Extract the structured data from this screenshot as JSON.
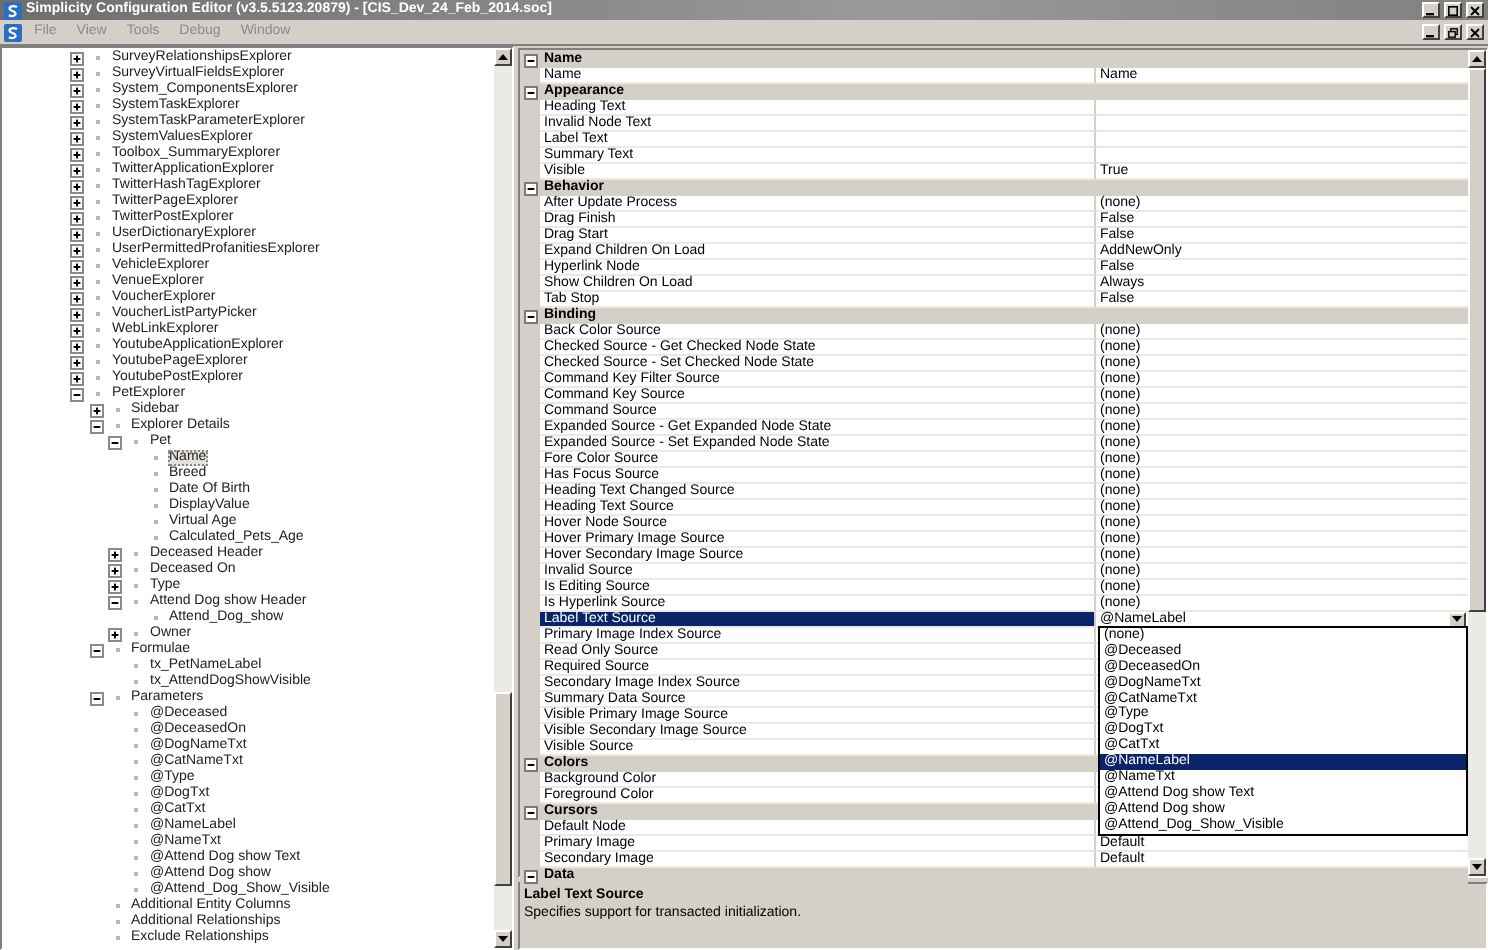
{
  "window": {
    "title": "Simplicity Configuration Editor (v3.5.5123.20879) - [CIS_Dev_24_Feb_2014.soc]"
  },
  "menu": [
    "File",
    "View",
    "Tools",
    "Debug",
    "Window"
  ],
  "tree": [
    {
      "label": "SurveyRelationshipsExplorer",
      "expanded": false,
      "selected": false
    },
    {
      "label": "SurveyVirtualFieldsExplorer",
      "expanded": false,
      "selected": false
    },
    {
      "label": "System_ComponentsExplorer",
      "expanded": false,
      "selected": false
    },
    {
      "label": "SystemTaskExplorer",
      "expanded": false,
      "selected": false
    },
    {
      "label": "SystemTaskParameterExplorer",
      "expanded": false,
      "selected": false
    },
    {
      "label": "SystemValuesExplorer",
      "expanded": false,
      "selected": false
    },
    {
      "label": "Toolbox_SummaryExplorer",
      "expanded": false,
      "selected": false
    },
    {
      "label": "TwitterApplicationExplorer",
      "expanded": false,
      "selected": false
    },
    {
      "label": "TwitterHashTagExplorer",
      "expanded": false,
      "selected": false
    },
    {
      "label": "TwitterPageExplorer",
      "expanded": false,
      "selected": false
    },
    {
      "label": "TwitterPostExplorer",
      "expanded": false,
      "selected": false
    },
    {
      "label": "UserDictionaryExplorer",
      "expanded": false,
      "selected": false
    },
    {
      "label": "UserPermittedProfanitiesExplorer",
      "expanded": false,
      "selected": false
    },
    {
      "label": "VehicleExplorer",
      "expanded": false,
      "selected": false
    },
    {
      "label": "VenueExplorer",
      "expanded": false,
      "selected": false
    },
    {
      "label": "VoucherExplorer",
      "expanded": false,
      "selected": false
    },
    {
      "label": "VoucherListPartyPicker",
      "expanded": false,
      "selected": false
    },
    {
      "label": "WebLinkExplorer",
      "expanded": false,
      "selected": false
    },
    {
      "label": "YoutubeApplicationExplorer",
      "expanded": false,
      "selected": false
    },
    {
      "label": "YoutubePageExplorer",
      "expanded": false,
      "selected": false
    },
    {
      "label": "YoutubePostExplorer",
      "expanded": false,
      "selected": false
    },
    {
      "label": "PetExplorer",
      "expanded": true,
      "selected": false,
      "children": [
        {
          "label": "Sidebar",
          "expanded": false,
          "selected": false
        },
        {
          "label": "Explorer Details",
          "expanded": true,
          "selected": false,
          "children": [
            {
              "label": "Pet",
              "expanded": true,
              "selected": false,
              "children": [
                {
                  "label": "Name",
                  "selected": true
                },
                {
                  "label": "Breed",
                  "selected": false
                },
                {
                  "label": "Date Of Birth",
                  "selected": false
                },
                {
                  "label": "DisplayValue",
                  "selected": false
                },
                {
                  "label": "Virtual Age",
                  "selected": false
                },
                {
                  "label": "Calculated_Pets_Age",
                  "selected": false
                }
              ]
            },
            {
              "label": "Deceased Header",
              "expanded": false,
              "selected": false
            },
            {
              "label": "Deceased On",
              "expanded": false,
              "selected": false
            },
            {
              "label": "Type",
              "expanded": false,
              "selected": false
            },
            {
              "label": "Attend Dog show Header",
              "expanded": true,
              "selected": false,
              "children": [
                {
                  "label": "Attend_Dog_show",
                  "selected": false
                }
              ]
            },
            {
              "label": "Owner",
              "expanded": false,
              "selected": false
            }
          ]
        },
        {
          "label": "Formulae",
          "expanded": true,
          "selected": false,
          "children": [
            {
              "label": "tx_PetNameLabel",
              "selected": false
            },
            {
              "label": "tx_AttendDogShowVisible",
              "selected": false
            }
          ]
        },
        {
          "label": "Parameters",
          "expanded": true,
          "selected": false,
          "children": [
            {
              "label": "@Deceased",
              "selected": false
            },
            {
              "label": "@DeceasedOn",
              "selected": false
            },
            {
              "label": "@DogNameTxt",
              "selected": false
            },
            {
              "label": "@CatNameTxt",
              "selected": false
            },
            {
              "label": "@Type",
              "selected": false
            },
            {
              "label": "@DogTxt",
              "selected": false
            },
            {
              "label": "@CatTxt",
              "selected": false
            },
            {
              "label": "@NameLabel",
              "selected": false
            },
            {
              "label": "@NameTxt",
              "selected": false
            },
            {
              "label": "@Attend Dog show Text",
              "selected": false
            },
            {
              "label": "@Attend Dog show",
              "selected": false
            },
            {
              "label": "@Attend_Dog_Show_Visible",
              "selected": false
            }
          ]
        },
        {
          "label": "Additional Entity Columns",
          "selected": false
        },
        {
          "label": "Additional Relationships",
          "selected": false
        },
        {
          "label": "Exclude Relationships",
          "selected": false
        }
      ]
    }
  ],
  "properties": [
    {
      "kind": "category",
      "label": "Name",
      "expanded": true
    },
    {
      "kind": "property",
      "name": "Name",
      "value": "Name",
      "selected": false
    },
    {
      "kind": "category",
      "label": "Appearance",
      "expanded": true
    },
    {
      "kind": "property",
      "name": "Heading Text",
      "selected": false
    },
    {
      "kind": "property",
      "name": "Invalid Node Text",
      "selected": false
    },
    {
      "kind": "property",
      "name": "Label Text",
      "selected": false
    },
    {
      "kind": "property",
      "name": "Summary Text",
      "selected": false
    },
    {
      "kind": "property",
      "name": "Visible",
      "value": "True",
      "selected": false
    },
    {
      "kind": "category",
      "label": "Behavior",
      "expanded": true
    },
    {
      "kind": "property",
      "name": "After Update Process",
      "value": "(none)",
      "selected": false
    },
    {
      "kind": "property",
      "name": "Drag Finish",
      "value": "False",
      "selected": false
    },
    {
      "kind": "property",
      "name": "Drag Start",
      "value": "False",
      "selected": false
    },
    {
      "kind": "property",
      "name": "Expand Children On Load",
      "value": "AddNewOnly",
      "selected": false
    },
    {
      "kind": "property",
      "name": "Hyperlink Node",
      "value": "False",
      "selected": false
    },
    {
      "kind": "property",
      "name": "Show Children On Load",
      "value": "Always",
      "selected": false
    },
    {
      "kind": "property",
      "name": "Tab Stop",
      "value": "False",
      "selected": false
    },
    {
      "kind": "category",
      "label": "Binding",
      "expanded": true
    },
    {
      "kind": "property",
      "name": "Back Color Source",
      "value": "(none)",
      "selected": false
    },
    {
      "kind": "property",
      "name": "Checked Source - Get Checked Node State",
      "value": "(none)",
      "selected": false
    },
    {
      "kind": "property",
      "name": "Checked Source - Set Checked Node State",
      "value": "(none)",
      "selected": false
    },
    {
      "kind": "property",
      "name": "Command Key Filter Source",
      "value": "(none)",
      "selected": false
    },
    {
      "kind": "property",
      "name": "Command Key Source",
      "value": "(none)",
      "selected": false
    },
    {
      "kind": "property",
      "name": "Command Source",
      "value": "(none)",
      "selected": false
    },
    {
      "kind": "property",
      "name": "Expanded Source - Get Expanded Node State",
      "value": "(none)",
      "selected": false
    },
    {
      "kind": "property",
      "name": "Expanded Source - Set Expanded Node State",
      "value": "(none)",
      "selected": false
    },
    {
      "kind": "property",
      "name": "Fore Color Source",
      "value": "(none)",
      "selected": false
    },
    {
      "kind": "property",
      "name": "Has Focus Source",
      "value": "(none)",
      "selected": false
    },
    {
      "kind": "property",
      "name": "Heading Text Changed Source",
      "value": "(none)",
      "selected": false
    },
    {
      "kind": "property",
      "name": "Heading Text Source",
      "value": "(none)",
      "selected": false
    },
    {
      "kind": "property",
      "name": "Hover Node Source",
      "value": "(none)",
      "selected": false
    },
    {
      "kind": "property",
      "name": "Hover Primary Image Source",
      "value": "(none)",
      "selected": false
    },
    {
      "kind": "property",
      "name": "Hover Secondary Image Source",
      "value": "(none)",
      "selected": false
    },
    {
      "kind": "property",
      "name": "Invalid Source",
      "value": "(none)",
      "selected": false
    },
    {
      "kind": "property",
      "name": "Is Editing Source",
      "value": "(none)",
      "selected": false
    },
    {
      "kind": "property",
      "name": "Is Hyperlink Source",
      "value": "(none)",
      "selected": false
    },
    {
      "kind": "property",
      "name": "Label Text Source",
      "value": "@NameLabel",
      "selected": true
    },
    {
      "kind": "property",
      "name": "Primary Image Index Source",
      "selected": false
    },
    {
      "kind": "property",
      "name": "Read Only Source",
      "selected": false
    },
    {
      "kind": "property",
      "name": "Required Source",
      "selected": false
    },
    {
      "kind": "property",
      "name": "Secondary Image Index Source",
      "selected": false
    },
    {
      "kind": "property",
      "name": "Summary Data Source",
      "selected": false
    },
    {
      "kind": "property",
      "name": "Visible Primary Image Source",
      "selected": false
    },
    {
      "kind": "property",
      "name": "Visible Secondary Image Source",
      "selected": false
    },
    {
      "kind": "property",
      "name": "Visible Source",
      "selected": false
    },
    {
      "kind": "category",
      "label": "Colors",
      "expanded": true
    },
    {
      "kind": "property",
      "name": "Background Color",
      "selected": false
    },
    {
      "kind": "property",
      "name": "Foreground Color",
      "selected": false
    },
    {
      "kind": "category",
      "label": "Cursors",
      "expanded": true
    },
    {
      "kind": "property",
      "name": "Default Node",
      "selected": false
    },
    {
      "kind": "property",
      "name": "Primary Image",
      "value": "Default",
      "selected": false
    },
    {
      "kind": "property",
      "name": "Secondary Image",
      "value": "Default",
      "selected": false
    },
    {
      "kind": "category",
      "label": "Data",
      "expanded": true
    }
  ],
  "dropdown": {
    "options": [
      {
        "label": "(none)",
        "selected": false
      },
      {
        "label": "@Deceased",
        "selected": false
      },
      {
        "label": "@DeceasedOn",
        "selected": false
      },
      {
        "label": "@DogNameTxt",
        "selected": false
      },
      {
        "label": "@CatNameTxt",
        "selected": false
      },
      {
        "label": "@Type",
        "selected": false
      },
      {
        "label": "@DogTxt",
        "selected": false
      },
      {
        "label": "@CatTxt",
        "selected": false
      },
      {
        "label": "@NameLabel",
        "selected": true
      },
      {
        "label": "@NameTxt",
        "selected": false
      },
      {
        "label": "@Attend Dog show Text",
        "selected": false
      },
      {
        "label": "@Attend Dog show",
        "selected": false
      },
      {
        "label": "@Attend_Dog_Show_Visible",
        "selected": false
      }
    ]
  },
  "description": {
    "title": "Label Text Source",
    "text": "Specifies support for transacted initialization."
  }
}
